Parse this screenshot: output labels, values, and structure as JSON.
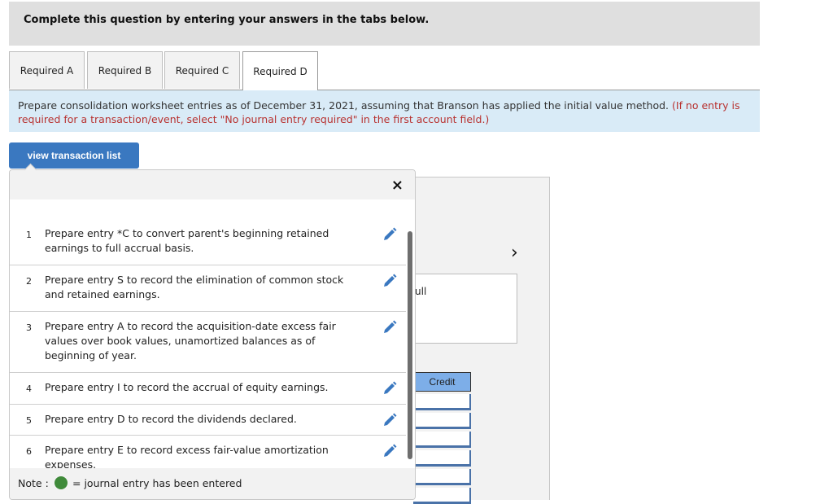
{
  "header": {
    "title": "Complete this question by entering your answers in the tabs below."
  },
  "tabs": [
    {
      "label": "Required A",
      "active": false
    },
    {
      "label": "Required B",
      "active": false
    },
    {
      "label": "Required C",
      "active": false
    },
    {
      "label": "Required D",
      "active": true
    }
  ],
  "instructions": {
    "text": "Prepare consolidation worksheet entries as of December 31, 2021, assuming that Branson has applied the initial value method.",
    "note": "(If no entry is required for a transaction/event, select \"No journal entry required\" in the first account field.)"
  },
  "view_transaction_button": "view transaction list",
  "popup": {
    "close_icon": "×",
    "items": [
      {
        "num": "1",
        "text": "Prepare entry *C to convert parent's beginning retained earnings to full accrual basis.",
        "icon": "pencil-icon"
      },
      {
        "num": "2",
        "text": "Prepare entry S to record the elimination of common stock and retained earnings.",
        "icon": "pencil-icon"
      },
      {
        "num": "3",
        "text": "Prepare entry A to record the acquisition-date excess fair values over book values, unamortized balances as of beginning of year.",
        "icon": "pencil-icon"
      },
      {
        "num": "4",
        "text": "Prepare entry I to record the accrual of equity earnings.",
        "icon": "pencil-icon"
      },
      {
        "num": "5",
        "text": "Prepare entry D to record the dividends declared.",
        "icon": "pencil-icon"
      },
      {
        "num": "6",
        "text": "Prepare entry E to record excess fair-value amortization expenses.",
        "icon": "pencil-icon"
      }
    ],
    "footer": {
      "label": "Note :",
      "legend_color": "#3f8a3a",
      "text": "= journal entry has been entered"
    }
  },
  "background": {
    "next_arrow": "›",
    "textbox_fragment": "ull",
    "credit_header": "Credit"
  },
  "colors": {
    "accent": "#3a78c0",
    "note_red": "#b8312f",
    "instructions_bg": "#d9ebf7",
    "credit_header_bg": "#7daee8"
  }
}
